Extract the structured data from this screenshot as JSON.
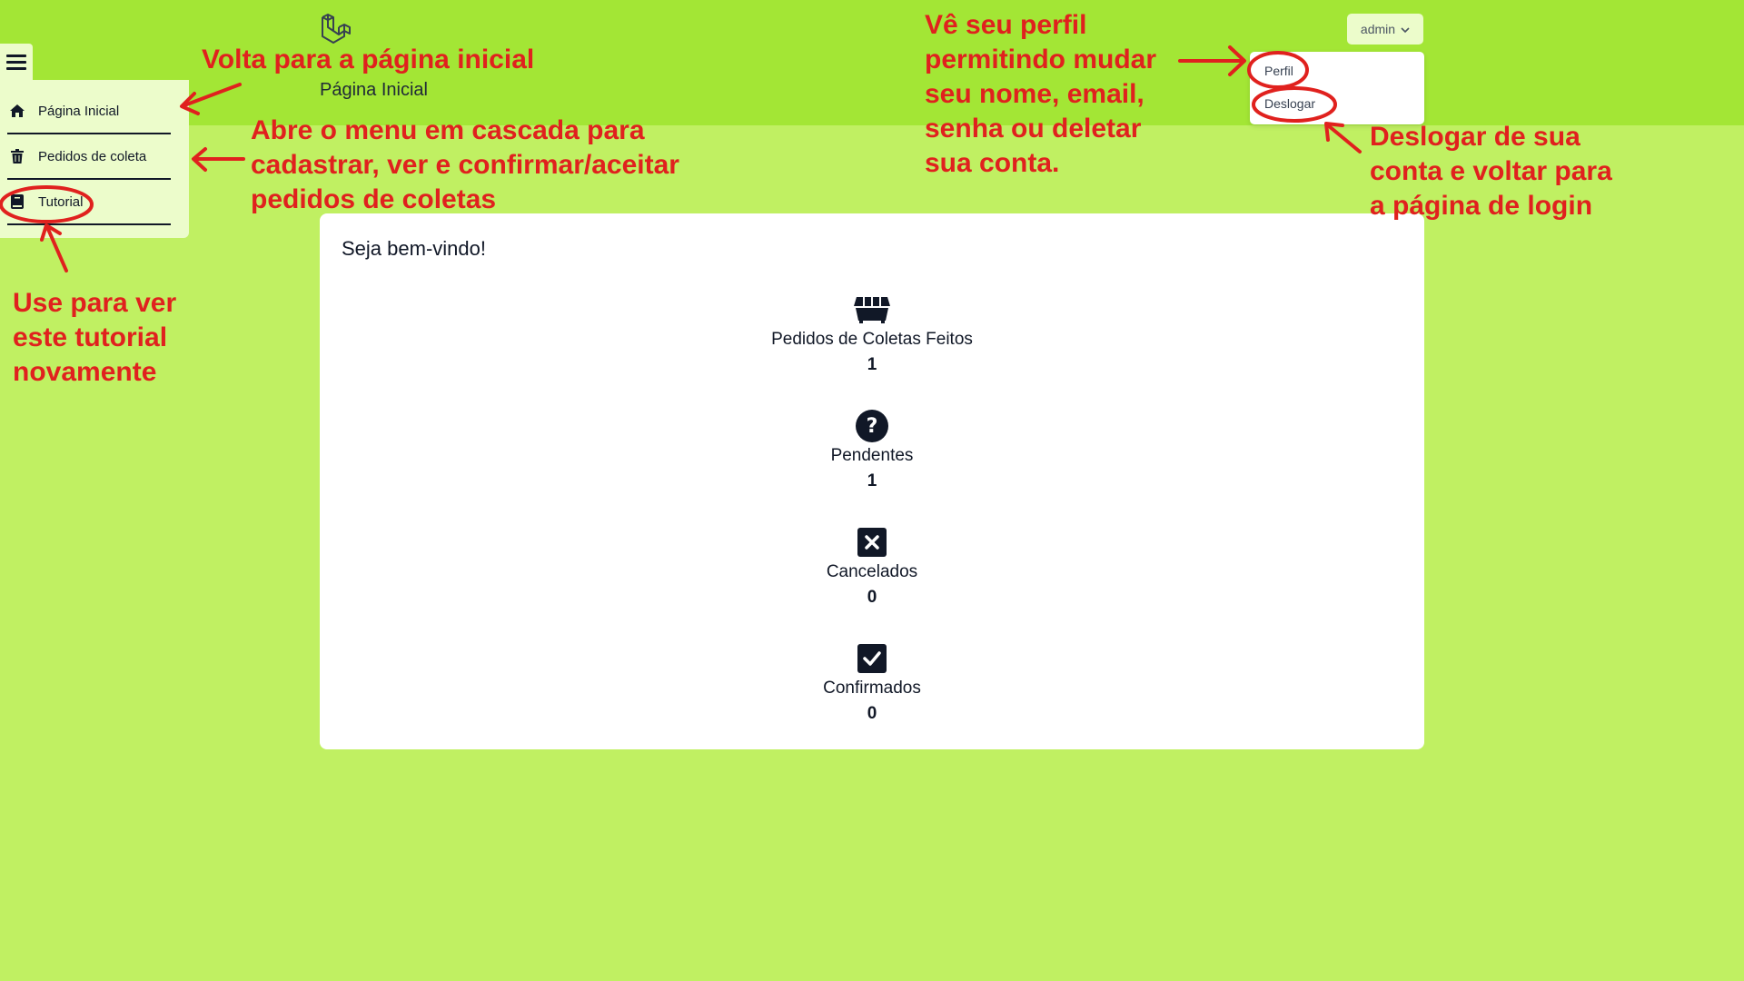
{
  "header": {
    "page_title": "Página Inicial",
    "user_menu": {
      "label": "admin",
      "items": [
        "Perfil",
        "Deslogar"
      ]
    }
  },
  "sidebar": {
    "items": [
      {
        "label": "Página Inicial",
        "icon": "home-icon"
      },
      {
        "label": "Pedidos de coleta",
        "icon": "trash-icon"
      },
      {
        "label": "Tutorial",
        "icon": "book-icon"
      }
    ]
  },
  "main": {
    "welcome": "Seja bem-vindo!",
    "stats": [
      {
        "label": "Pedidos de Coletas Feitos",
        "value": "1",
        "icon": "dumpster-icon"
      },
      {
        "label": "Pendentes",
        "value": "1",
        "icon": "question-circle-icon"
      },
      {
        "label": "Cancelados",
        "value": "0",
        "icon": "x-square-icon"
      },
      {
        "label": "Confirmados",
        "value": "0",
        "icon": "check-square-icon"
      }
    ]
  },
  "annotations": {
    "home": "Volta para a página inicial",
    "cascade": [
      "Abre o menu em cascada para",
      "cadastrar, ver e confirmar/aceitar",
      "pedidos de coletas"
    ],
    "tutorial": [
      "Use para ver",
      "este tutorial",
      "novamente"
    ],
    "profile": [
      "Vê seu perfil",
      "permitindo mudar",
      "seu nome, email,",
      "senha ou deletar",
      "sua conta."
    ],
    "logout": [
      "Deslogar de sua",
      "conta e voltar para",
      "a página de login"
    ]
  },
  "colors": {
    "background": "#c0f062",
    "topbar": "#a3e635",
    "panel": "#ecfccb",
    "annotation": "#e0211e",
    "dark": "#111827"
  }
}
